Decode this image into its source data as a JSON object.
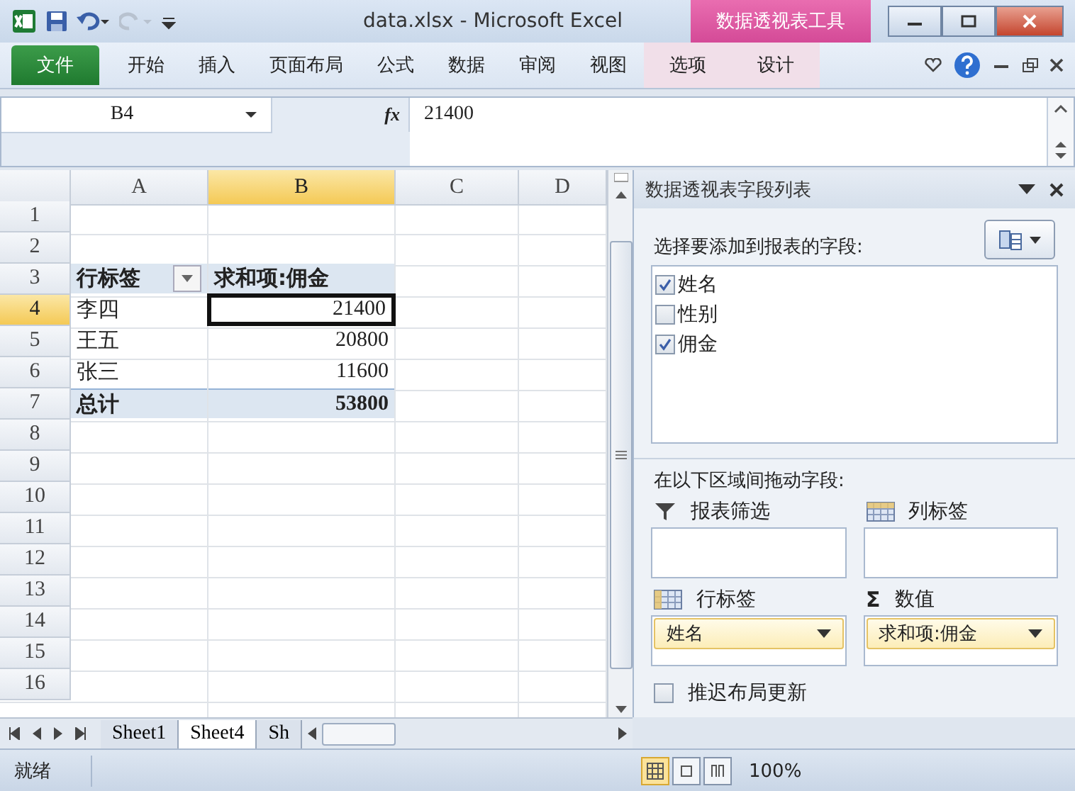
{
  "window": {
    "title": "data.xlsx  -  Microsoft Excel",
    "context_group": "数据透视表工具"
  },
  "ribbon_tabs": [
    {
      "label": "文件",
      "kind": "file"
    },
    {
      "label": "开始",
      "kind": "normal"
    },
    {
      "label": "插入",
      "kind": "normal"
    },
    {
      "label": "页面布局",
      "kind": "normal"
    },
    {
      "label": "公式",
      "kind": "normal"
    },
    {
      "label": "数据",
      "kind": "normal"
    },
    {
      "label": "审阅",
      "kind": "normal"
    },
    {
      "label": "视图",
      "kind": "normal"
    },
    {
      "label": "选项",
      "kind": "contextual"
    },
    {
      "label": "设计",
      "kind": "contextual"
    }
  ],
  "formula_bar": {
    "name_box": "B4",
    "function_label": "fx",
    "value": "21400"
  },
  "sheet": {
    "columns": [
      {
        "label": "A",
        "selected": false
      },
      {
        "label": "B",
        "selected": true
      },
      {
        "label": "C",
        "selected": false
      },
      {
        "label": "D",
        "selected": false
      }
    ],
    "rows": [
      {
        "number": "1",
        "selected": false
      },
      {
        "number": "2",
        "selected": false
      },
      {
        "number": "3",
        "selected": false,
        "kind": "header",
        "cells": [
          "行标签",
          "求和项:佣金"
        ]
      },
      {
        "number": "4",
        "selected": true,
        "kind": "item",
        "cells": [
          "李四",
          "21400"
        ]
      },
      {
        "number": "5",
        "selected": false,
        "kind": "item",
        "cells": [
          "王五",
          "20800"
        ]
      },
      {
        "number": "6",
        "selected": false,
        "kind": "item",
        "cells": [
          "张三",
          "11600"
        ]
      },
      {
        "number": "7",
        "selected": false,
        "kind": "total",
        "cells": [
          "总计",
          "53800"
        ]
      },
      {
        "number": "8",
        "selected": false
      },
      {
        "number": "9",
        "selected": false
      },
      {
        "number": "10",
        "selected": false
      },
      {
        "number": "11",
        "selected": false
      },
      {
        "number": "12",
        "selected": false
      },
      {
        "number": "13",
        "selected": false
      },
      {
        "number": "14",
        "selected": false
      },
      {
        "number": "15",
        "selected": false
      },
      {
        "number": "16",
        "selected": false
      }
    ]
  },
  "sheet_tabs": [
    {
      "label": "Sheet1",
      "selected": false
    },
    {
      "label": "Sheet4",
      "selected": true
    },
    {
      "label": "Sh",
      "selected": false
    }
  ],
  "field_list": {
    "title": "数据透视表字段列表",
    "prompt": "选择要添加到报表的字段:",
    "fields": [
      {
        "label": "姓名",
        "checked": true
      },
      {
        "label": "性别",
        "checked": false
      },
      {
        "label": "佣金",
        "checked": true
      }
    ],
    "areas_prompt": "在以下区域间拖动字段:",
    "areas": [
      {
        "label": "报表筛选",
        "kind": "filter"
      },
      {
        "label": "列标签",
        "kind": "columns"
      },
      {
        "label": "行标签",
        "kind": "rows",
        "items": [
          "姓名"
        ]
      },
      {
        "label": "数值",
        "kind": "values",
        "icon": "Σ",
        "items": [
          "求和项:佣金"
        ]
      }
    ],
    "defer_update": {
      "label": "推迟布局更新",
      "checked": false
    }
  },
  "status_bar": {
    "text": "就绪",
    "zoom": "100%"
  }
}
